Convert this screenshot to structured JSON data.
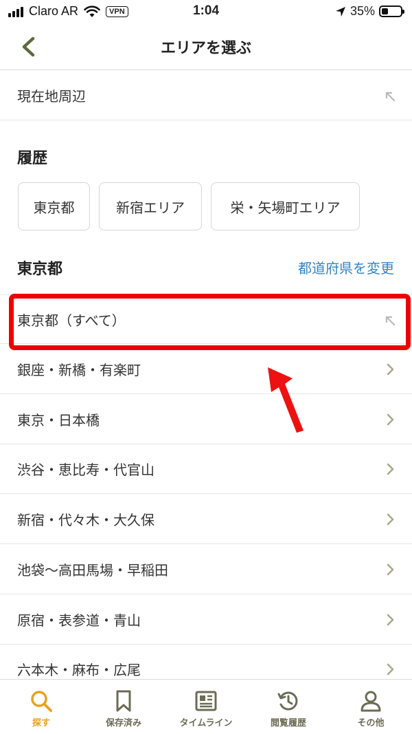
{
  "status_bar": {
    "carrier": "Claro AR",
    "vpn": "VPN",
    "time": "1:04",
    "battery": "35%"
  },
  "nav": {
    "title": "エリアを選ぶ",
    "back_icon": "chevron-left-icon"
  },
  "current_location": {
    "label": "現在地周辺",
    "icon": "arrow-up-left-icon"
  },
  "history": {
    "title": "履歴",
    "chips": [
      "東京都",
      "新宿エリア",
      "栄・矢場町エリア"
    ]
  },
  "prefecture": {
    "title": "東京都",
    "change_link": "都道府県を変更",
    "all_label": "東京都（すべて）",
    "areas": [
      "銀座・新橋・有楽町",
      "東京・日本橋",
      "渋谷・恵比寿・代官山",
      "新宿・代々木・大久保",
      "池袋～高田馬場・早稲田",
      "原宿・表参道・青山",
      "六本木・麻布・広尾"
    ]
  },
  "tabbar": {
    "tabs": [
      {
        "label": "探す",
        "icon": "search-icon",
        "active": true
      },
      {
        "label": "保存済み",
        "icon": "bookmark-icon",
        "active": false
      },
      {
        "label": "タイムライン",
        "icon": "newspaper-icon",
        "active": false
      },
      {
        "label": "閲覧履歴",
        "icon": "history-clock-icon",
        "active": false
      },
      {
        "label": "その他",
        "icon": "person-icon",
        "active": false
      }
    ]
  },
  "colors": {
    "accent_orange": "#e8a21c",
    "icon_olive": "#6b6b55",
    "link_blue": "#3583c5",
    "highlight_red": "#ee0000"
  }
}
